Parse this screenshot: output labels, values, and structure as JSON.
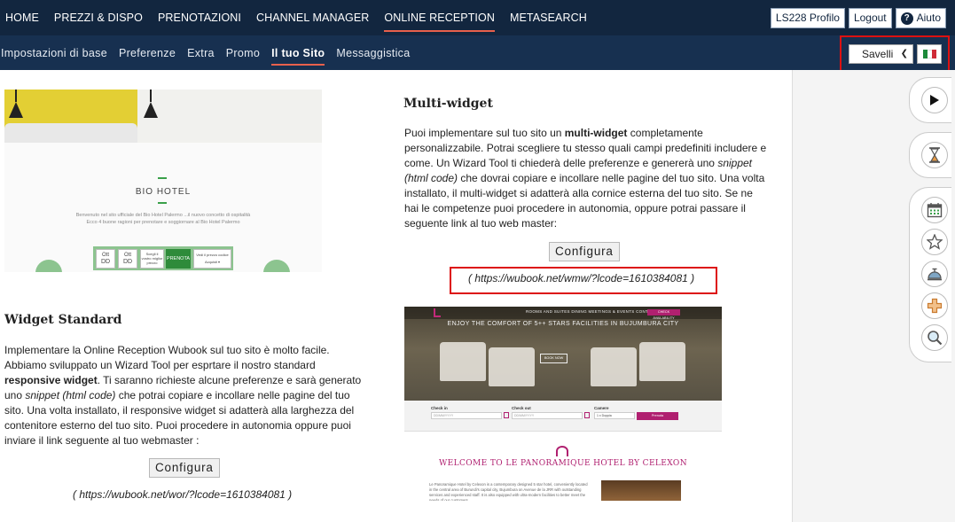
{
  "topnav": {
    "items": [
      "HOME",
      "PREZZI & DISPO",
      "PRENOTAZIONI",
      "CHANNEL MANAGER",
      "ONLINE RECEPTION",
      "METASEARCH"
    ],
    "active_index": 4,
    "profile_label": "LS228 Profilo",
    "logout_label": "Logout",
    "help_label": "Aiuto"
  },
  "subnav": {
    "items": [
      "Impostazioni di base",
      "Preferenze",
      "Extra",
      "Promo",
      "Il tuo Sito",
      "Messaggistica"
    ],
    "active_index": 4,
    "hotel_select_value": "Savelli",
    "language_flag": "italy-flag-icon"
  },
  "standard_preview": {
    "title": "BIO HOTEL",
    "text_line1": "Benvenuto nel sito ufficiale del Bio Hotel Palermo ...il nuovo concetto di ospitalità",
    "text_line2": "Ecco 4 buone ragioni per prenotare e soggiornare al Bio Hotel Palermo",
    "form": {
      "cell1_month": "Ott",
      "cell1_day": "DD",
      "cell2_month": "Ott",
      "cell2_day": "DD",
      "cell3": "Scegli il vostro miglior prezzo",
      "button": "PRENOTA",
      "cell4_label": "Vedi il prezzo codice",
      "cell4_value": "Acquisti ▾"
    }
  },
  "widget_standard": {
    "heading": "Widget Standard",
    "p1": "Implementare la Online Reception Wubook sul tuo sito è molto facile. Abbiamo sviluppato un Wizard Tool per esprtare il nostro standard ",
    "p1_bold": "responsive widget",
    "p2": ". Ti saranno richieste alcune preferenze e sarà generato uno ",
    "p2_italic": "snippet (html code)",
    "p3": " che potrai copiare e incollare nelle pagine del tuo sito. Una volta installato, il responsive widget si adatterà alla larghezza del contenitore esterno del tuo sito. Puoi procedere in autonomia oppure puoi inviare il link seguente al tuo webmaster :",
    "configure_label": "Configura",
    "link": "( https://wubook.net/wor/?lcode=1610384081 )"
  },
  "multi_widget": {
    "heading": "Multi-widget",
    "p1": "Puoi implementare sul tuo sito un ",
    "p1_bold": "multi-widget",
    "p2": " completamente personalizzabile. Potrai scegliere tu stesso quali campi predefiniti includere e come. Un Wizard Tool ti chiederà delle preferenze e genererà uno ",
    "p2_italic": "snippet (html code)",
    "p3": " che dovrai copiare e incollare nelle pagine del tuo sito. Una volta installato, il multi-widget si adatterà alla cornice esterna del tuo sito. Se ne hai le competenze puoi procedere in autonomia, oppure potrai passare il seguente link al tuo web master:",
    "configure_label": "Configura",
    "link": "( https://wubook.net/wmw/?lcode=1610384081 )"
  },
  "multi_preview": {
    "nav_links": "ROOMS AND SUITES     DINING     MEETINGS & EVENTS     CONTACT",
    "nav_button": "CHECK AVAILABILITY",
    "hero_title": "ENJOY THE COMFORT OF 5++ STARS FACILITIES IN BUJUMBURA CITY",
    "hero_button": "BOOK NOW",
    "checkin_label": "Check in",
    "checkin_placeholder": "DD/MM/YYYY",
    "checkout_label": "Check out",
    "checkout_placeholder": "DD/MM/YYYY",
    "rooms_label": "Camere",
    "rooms_value": "1 x Doppia",
    "submit": "Prenota",
    "welcome": "WELCOME TO LE PANORAMIQUE HOTEL BY CELEXON",
    "body": "Le Panoramique Hotel by Celexon is a contemporary designed 5 star hotel, conveniently located in the central area of Burundi's capital city, Bujumbura on Avenue de la JRR with outstanding services and experienced staff. It is also equipped with ultra-modern facilities to better meet the needs of our customers."
  },
  "quick_panel": {
    "icons": [
      "play-icon",
      "hourglass-icon",
      "calendar-icon",
      "star-icon",
      "service-bell-icon",
      "plus-icon",
      "search-icon"
    ]
  },
  "colors": {
    "nav_bg": "#12263f",
    "subnav_bg": "#173050",
    "active_underline": "#e8604c",
    "highlight_red": "#dd1111",
    "brand_magenta": "#b02070",
    "bio_green": "#3aa04a"
  }
}
